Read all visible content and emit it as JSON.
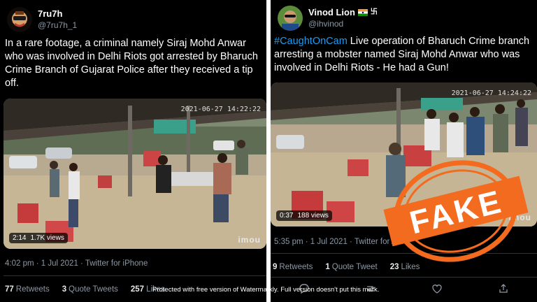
{
  "left": {
    "display_name": "7ru7h",
    "handle": "@7ru7h_1",
    "text": "In a rare footage, a criminal namely Siraj Mohd Anwar who was involved in Delhi Riots got arrested by Bharuch Crime Branch of Gujarat Police after they received a tip off.",
    "video": {
      "duration": "2:14",
      "views": "1.7K views",
      "camera_watermark": "imou",
      "timestamp": "2021-06-27 14:22:22"
    },
    "meta": "4:02 pm · 1 Jul 2021 · Twitter for iPhone",
    "stats": [
      {
        "count": "77",
        "label": "Retweets"
      },
      {
        "count": "3",
        "label": "Quote Tweets"
      },
      {
        "count": "257",
        "label": "Likes"
      }
    ]
  },
  "right": {
    "display_name": "Vinod Lion",
    "handle": "@ihvinod",
    "hashtag": "#CaughtOnCam",
    "text": " Live operation of Bharuch Crime branch arresting a mobster named Siraj Mohd Anwar who was involved in Delhi Riots - He had a Gun!",
    "video": {
      "duration": "0:37",
      "views": "188 views",
      "camera_watermark": "imou",
      "timestamp": "2021-06-27 14:24:22"
    },
    "meta": "5:35 pm · 1 Jul 2021 · Twitter for Ar",
    "stats": [
      {
        "count": "9",
        "label": "Retweets"
      },
      {
        "count": "1",
        "label": "Quote Tweet"
      },
      {
        "count": "23",
        "label": "Likes"
      }
    ],
    "action_icons": [
      "reply-icon",
      "retweet-icon",
      "like-icon",
      "share-icon"
    ]
  },
  "stamp": {
    "text": "FAKE",
    "color": "#f26b1f"
  },
  "watermark": "Protected with free version of Watermarkly. Full version doesn't put this mark.",
  "colors": {
    "link": "#1d9bf0",
    "muted": "#8b98a5",
    "bg": "#000000"
  }
}
